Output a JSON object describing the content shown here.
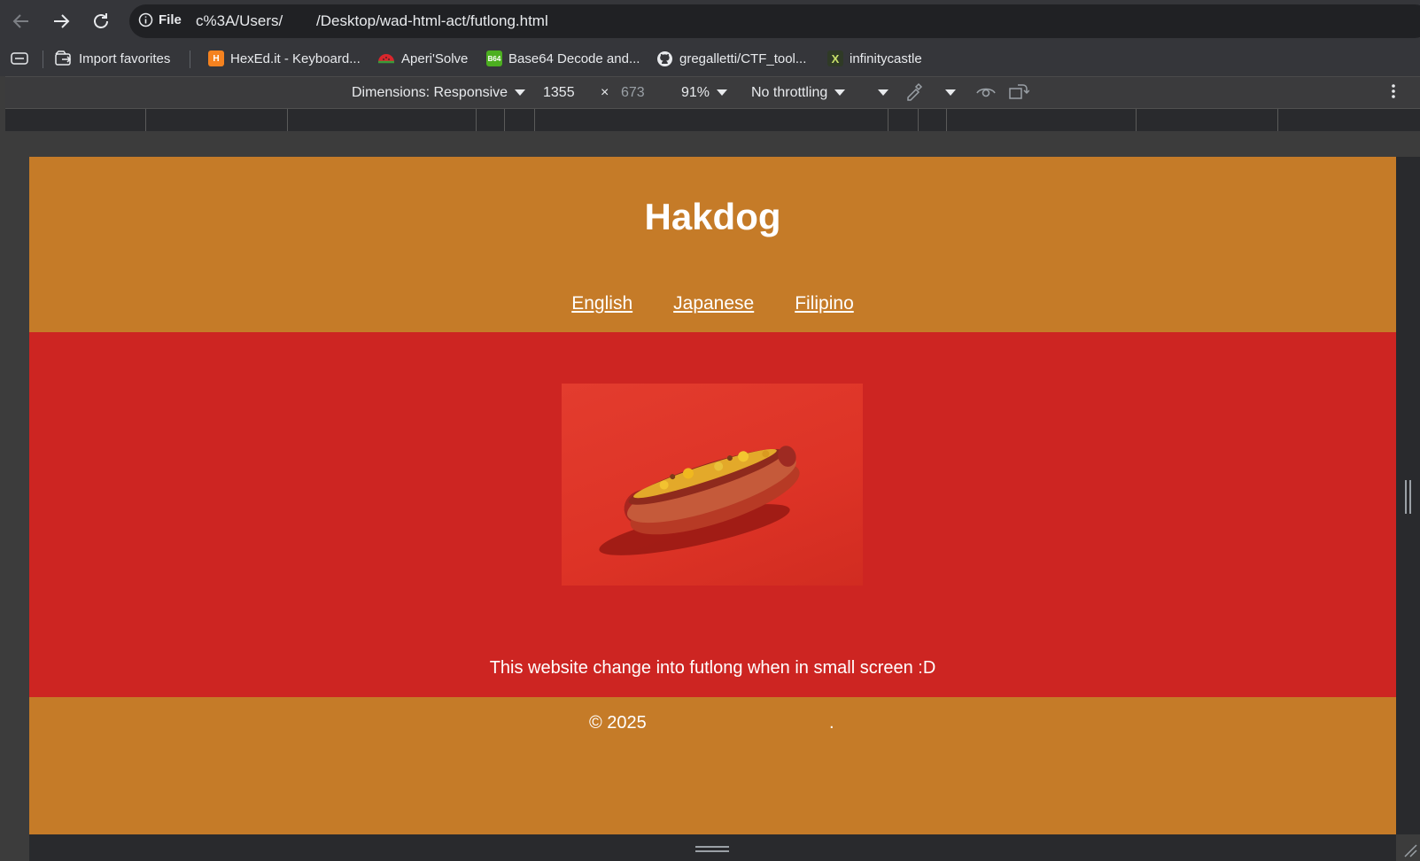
{
  "browser": {
    "site_info_label": "File",
    "url": "c%3A/Users/        /Desktop/wad-html-act/futlong.html",
    "icons": {
      "back": "arrow-left-icon",
      "forward": "arrow-right-icon",
      "reload": "reload-icon",
      "info": "info-icon"
    }
  },
  "bookmarks": [
    {
      "label": "Import favorites",
      "icon": "import-icon"
    },
    {
      "label": "HexEd.it - Keyboard...",
      "icon": "hexed-favicon",
      "color": "#f5821f"
    },
    {
      "label": "Aperi'Solve",
      "icon": "watermelon-favicon"
    },
    {
      "label": "Base64 Decode and...",
      "icon": "b64-favicon",
      "color": "#4caf20"
    },
    {
      "label": "gregalletti/CTF_tool...",
      "icon": "github-icon"
    },
    {
      "label": "infinitycastle",
      "icon": "x-favicon"
    }
  ],
  "devtools": {
    "dimensions_label": "Dimensions: Responsive",
    "width": "1355",
    "times": "×",
    "height": "673",
    "zoom": "91%",
    "throttling": "No throttling"
  },
  "site": {
    "title": "Hakdog",
    "nav": [
      "English",
      "Japanese",
      "Filipino"
    ],
    "tagline": "This website change into futlong when in small screen :D",
    "copyright": "© 2025",
    "footer_dot": ".",
    "colors": {
      "header": "#c57b28",
      "main": "#cd2522",
      "footer": "#c57b28"
    }
  }
}
